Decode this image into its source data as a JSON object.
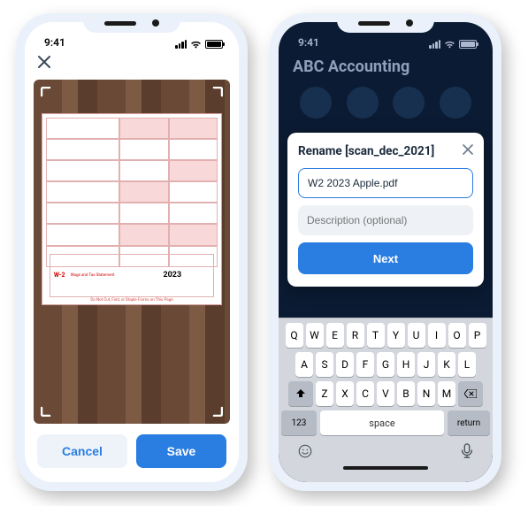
{
  "statusBar": {
    "time": "9:41"
  },
  "phone1": {
    "form": {
      "tag": "W-2",
      "title": "Wage and Tax Statement",
      "year": "2023",
      "footer": "Do Not Cut, Fold, or Staple Forms on This Page"
    },
    "buttons": {
      "cancel": "Cancel",
      "save": "Save"
    }
  },
  "phone2": {
    "app": {
      "title": "ABC Accounting"
    },
    "modal": {
      "title": "Rename [scan_dec_2021]",
      "filename": "W2 2023 Apple.pdf",
      "descPlaceholder": "Description (optional)",
      "next": "Next"
    },
    "keyboard": {
      "row1": [
        "Q",
        "W",
        "E",
        "R",
        "T",
        "Y",
        "U",
        "I",
        "O",
        "P"
      ],
      "row2": [
        "A",
        "S",
        "D",
        "F",
        "G",
        "H",
        "J",
        "K",
        "L"
      ],
      "row3": [
        "Z",
        "X",
        "C",
        "V",
        "B",
        "N",
        "M"
      ],
      "k123": "123",
      "space": "space",
      "ret": "return"
    }
  }
}
